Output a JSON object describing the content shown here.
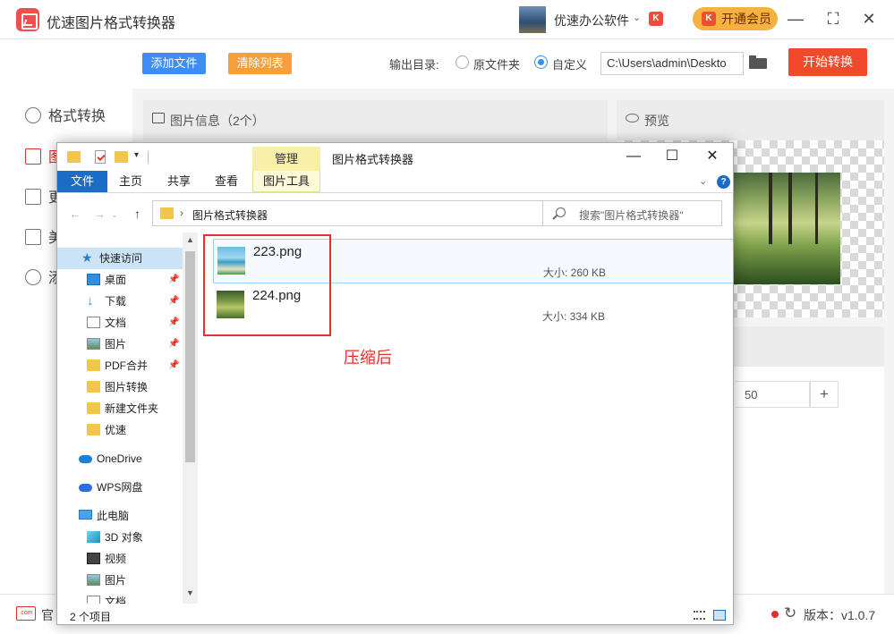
{
  "app": {
    "title": "优速图片格式转换器",
    "brand": "优速办公软件",
    "vip": "开通会员",
    "minimize": "—",
    "maximize": "⛶",
    "close": "✕"
  },
  "toolbar": {
    "add_file": "添加文件",
    "clear_list": "清除列表",
    "output_label": "输出目录:",
    "opt_original": "原文件夹",
    "opt_custom": "自定义",
    "path": "C:\\Users\\admin\\Deskto",
    "start": "开始转换"
  },
  "sidebar": {
    "items": [
      "格式转换",
      "图",
      "更",
      "美",
      "添"
    ]
  },
  "panels": {
    "info_title": "图片信息（2个）",
    "preview_title": "预览",
    "quality_value": "50",
    "plus": "+"
  },
  "status": {
    "site_icon": ".com",
    "site_label": "官",
    "version": "版本：v1.0.7"
  },
  "explorer": {
    "manage_tab": "管理",
    "title": "图片格式转换器",
    "tabs": [
      "文件",
      "主页",
      "共享",
      "查看",
      "图片工具"
    ],
    "address": "图片格式转换器",
    "search_placeholder": "搜索\"图片格式转换器\"",
    "nav": [
      {
        "label": "快速访问",
        "icon": "star"
      },
      {
        "label": "桌面",
        "icon": "desk",
        "pin": true
      },
      {
        "label": "下载",
        "icon": "dl",
        "pin": true
      },
      {
        "label": "文档",
        "icon": "doc",
        "pin": true
      },
      {
        "label": "图片",
        "icon": "pic",
        "pin": true
      },
      {
        "label": "PDF合并",
        "icon": "folder",
        "pin": true
      },
      {
        "label": "图片转换",
        "icon": "folder"
      },
      {
        "label": "新建文件夹",
        "icon": "folder"
      },
      {
        "label": "优速",
        "icon": "folder"
      },
      {
        "label": "OneDrive",
        "icon": "cloud"
      },
      {
        "label": "WPS网盘",
        "icon": "wps"
      },
      {
        "label": "此电脑",
        "icon": "pc"
      },
      {
        "label": "3D 对象",
        "icon": "obj3d"
      },
      {
        "label": "视频",
        "icon": "vid"
      },
      {
        "label": "图片",
        "icon": "pic"
      },
      {
        "label": "文档",
        "icon": "doc"
      }
    ],
    "files": [
      {
        "name": "223.png",
        "size": "大小: 260 KB"
      },
      {
        "name": "224.png",
        "size": "大小: 334 KB"
      }
    ],
    "annotation": "压缩后",
    "status": "2 个项目"
  }
}
